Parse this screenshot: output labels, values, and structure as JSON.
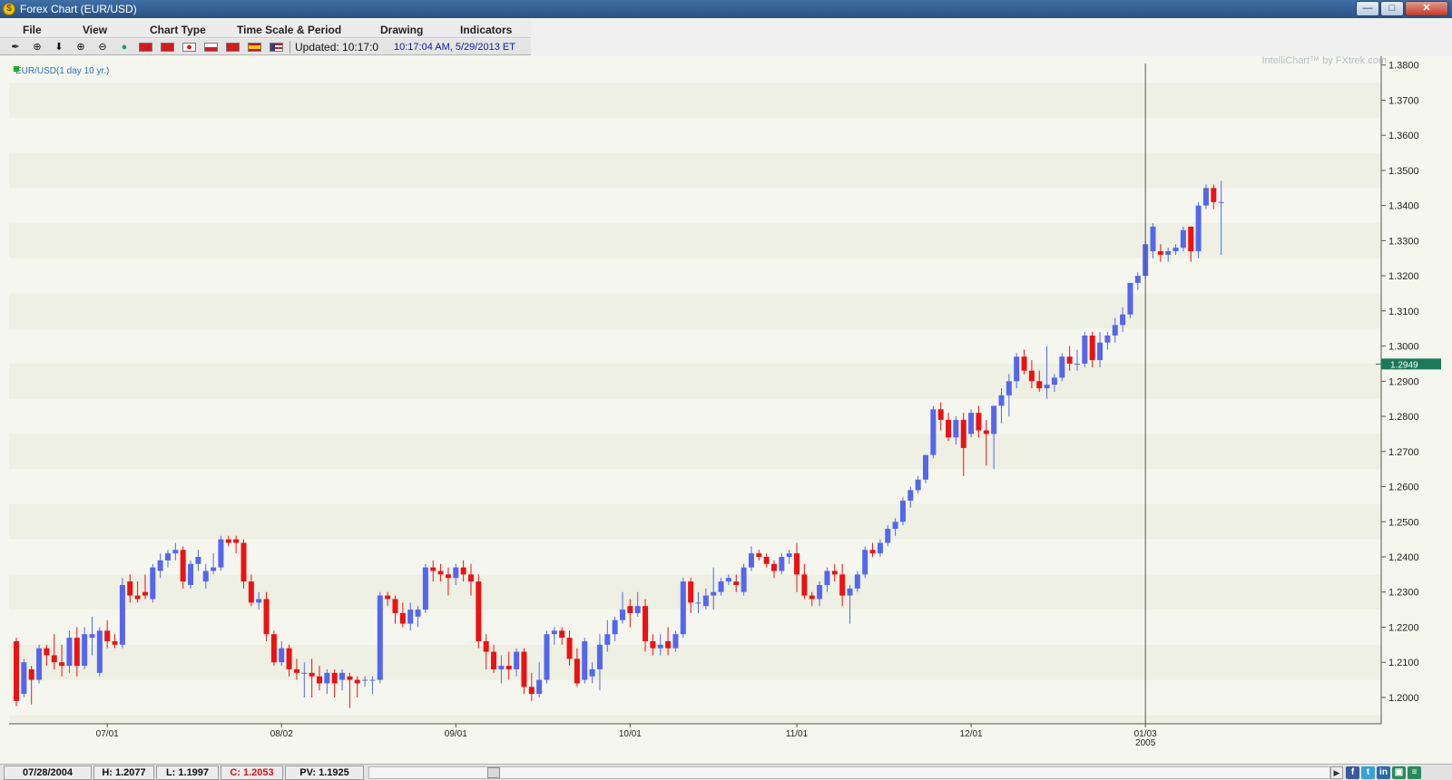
{
  "window": {
    "title": "Forex Chart (EUR/USD)",
    "icon": "fxtrek-logo-icon"
  },
  "menus": [
    "File",
    "View",
    "Chart Type",
    "Time Scale & Period",
    "Drawing",
    "Indicators"
  ],
  "toolbar": {
    "tools": [
      "pencil-icon",
      "crosshair-icon",
      "down-arrow-icon",
      "zoom-in-icon",
      "zoom-out-icon",
      "globe-icon"
    ],
    "flags": [
      {
        "name": "china-flag-icon",
        "color": "#d71920"
      },
      {
        "name": "hong-kong-flag-icon",
        "color": "#d71920"
      },
      {
        "name": "japan-flag-icon",
        "color": "#ffffff"
      },
      {
        "name": "poland-flag-icon",
        "color": "#ffffff"
      },
      {
        "name": "turkey-flag-icon",
        "color": "#d71920"
      },
      {
        "name": "spain-flag-icon",
        "color": "#e8a300"
      },
      {
        "name": "usa-flag-icon",
        "color": "#3c3b6e"
      }
    ],
    "updated_label": "Updated: 10:17:0",
    "updated_time": "10:17:04 AM, 5/29/2013 ET"
  },
  "chart": {
    "legend": "EUR/USD(1 day  10 yr.)",
    "watermark": "IntelliChart™ by FXtrek.com",
    "current_price_label": "1.2949",
    "year_label": "2005",
    "colors": {
      "up": "#5566ee",
      "down": "#ee1111",
      "price_tag": "#1a7a5a",
      "band_a": "#f5f7ef",
      "band_b": "#edf0e2"
    }
  },
  "chart_data": {
    "type": "candlestick",
    "symbol": "EUR/USD",
    "period": "1 day",
    "ylim": [
      1.1925,
      1.3825
    ],
    "yticks": [
      "1.2000",
      "1.2100",
      "1.2200",
      "1.2300",
      "1.2400",
      "1.2500",
      "1.2600",
      "1.2700",
      "1.2800",
      "1.2900",
      "1.3000",
      "1.3100",
      "1.3200",
      "1.3300",
      "1.3400",
      "1.3500",
      "1.3600",
      "1.3700",
      "1.3800"
    ],
    "xticks": [
      {
        "label": "07/01",
        "index": 12
      },
      {
        "label": "08/02",
        "index": 35
      },
      {
        "label": "09/01",
        "index": 58
      },
      {
        "label": "10/01",
        "index": 81
      },
      {
        "label": "11/01",
        "index": 103
      },
      {
        "label": "12/01",
        "index": 126
      },
      {
        "label": "01/03",
        "index": 149
      }
    ],
    "marker_index": 149,
    "current_price": 1.2949,
    "candles": [
      [
        1.216,
        1.217,
        1.1975,
        1.199
      ],
      [
        1.201,
        1.211,
        1.2,
        1.21
      ],
      [
        1.208,
        1.209,
        1.198,
        1.205
      ],
      [
        1.205,
        1.215,
        1.204,
        1.214
      ],
      [
        1.214,
        1.215,
        1.209,
        1.212
      ],
      [
        1.212,
        1.218,
        1.208,
        1.21
      ],
      [
        1.21,
        1.215,
        1.206,
        1.209
      ],
      [
        1.209,
        1.219,
        1.207,
        1.217
      ],
      [
        1.217,
        1.22,
        1.206,
        1.209
      ],
      [
        1.209,
        1.22,
        1.208,
        1.218
      ],
      [
        1.217,
        1.223,
        1.212,
        1.218
      ],
      [
        1.207,
        1.22,
        1.206,
        1.219
      ],
      [
        1.219,
        1.222,
        1.214,
        1.216
      ],
      [
        1.216,
        1.218,
        1.214,
        1.215
      ],
      [
        1.215,
        1.234,
        1.214,
        1.232
      ],
      [
        1.233,
        1.235,
        1.227,
        1.229
      ],
      [
        1.229,
        1.233,
        1.227,
        1.228
      ],
      [
        1.23,
        1.235,
        1.228,
        1.229
      ],
      [
        1.228,
        1.238,
        1.227,
        1.237
      ],
      [
        1.236,
        1.241,
        1.234,
        1.239
      ],
      [
        1.239,
        1.242,
        1.237,
        1.241
      ],
      [
        1.241,
        1.244,
        1.239,
        1.242
      ],
      [
        1.242,
        1.243,
        1.231,
        1.233
      ],
      [
        1.232,
        1.239,
        1.231,
        1.238
      ],
      [
        1.238,
        1.242,
        1.236,
        1.24
      ],
      [
        1.233,
        1.238,
        1.231,
        1.236
      ],
      [
        1.236,
        1.241,
        1.235,
        1.237
      ],
      [
        1.237,
        1.246,
        1.236,
        1.245
      ],
      [
        1.245,
        1.246,
        1.243,
        1.244
      ],
      [
        1.245,
        1.246,
        1.241,
        1.244
      ],
      [
        1.244,
        1.245,
        1.231,
        1.233
      ],
      [
        1.233,
        1.235,
        1.226,
        1.227
      ],
      [
        1.227,
        1.23,
        1.225,
        1.228
      ],
      [
        1.228,
        1.23,
        1.216,
        1.218
      ],
      [
        1.218,
        1.219,
        1.209,
        1.21
      ],
      [
        1.21,
        1.216,
        1.209,
        1.214
      ],
      [
        1.214,
        1.215,
        1.206,
        1.208
      ],
      [
        1.208,
        1.211,
        1.205,
        1.207
      ],
      [
        1.207,
        1.21,
        1.2,
        1.207
      ],
      [
        1.207,
        1.211,
        1.2,
        1.206
      ],
      [
        1.206,
        1.209,
        1.202,
        1.204
      ],
      [
        1.204,
        1.208,
        1.201,
        1.207
      ],
      [
        1.207,
        1.208,
        1.2,
        1.204
      ],
      [
        1.205,
        1.208,
        1.202,
        1.207
      ],
      [
        1.206,
        1.207,
        1.197,
        1.205
      ],
      [
        1.205,
        1.206,
        1.2,
        1.204
      ],
      [
        1.205,
        1.206,
        1.203,
        1.205
      ],
      [
        1.205,
        1.206,
        1.201,
        1.205
      ],
      [
        1.205,
        1.23,
        1.204,
        1.229
      ],
      [
        1.229,
        1.23,
        1.226,
        1.228
      ],
      [
        1.228,
        1.229,
        1.221,
        1.224
      ],
      [
        1.224,
        1.227,
        1.22,
        1.221
      ],
      [
        1.221,
        1.227,
        1.219,
        1.225
      ],
      [
        1.223,
        1.226,
        1.22,
        1.225
      ],
      [
        1.225,
        1.238,
        1.224,
        1.237
      ],
      [
        1.237,
        1.239,
        1.233,
        1.236
      ],
      [
        1.236,
        1.238,
        1.233,
        1.235
      ],
      [
        1.235,
        1.237,
        1.229,
        1.234
      ],
      [
        1.234,
        1.238,
        1.232,
        1.237
      ],
      [
        1.237,
        1.239,
        1.233,
        1.235
      ],
      [
        1.235,
        1.238,
        1.229,
        1.233
      ],
      [
        1.233,
        1.235,
        1.214,
        1.216
      ],
      [
        1.216,
        1.218,
        1.208,
        1.213
      ],
      [
        1.213,
        1.215,
        1.207,
        1.208
      ],
      [
        1.208,
        1.212,
        1.204,
        1.209
      ],
      [
        1.209,
        1.213,
        1.205,
        1.208
      ],
      [
        1.208,
        1.214,
        1.206,
        1.213
      ],
      [
        1.213,
        1.214,
        1.201,
        1.203
      ],
      [
        1.203,
        1.207,
        1.199,
        1.201
      ],
      [
        1.201,
        1.21,
        1.2,
        1.205
      ],
      [
        1.205,
        1.219,
        1.204,
        1.218
      ],
      [
        1.218,
        1.22,
        1.215,
        1.219
      ],
      [
        1.219,
        1.22,
        1.215,
        1.217
      ],
      [
        1.217,
        1.219,
        1.209,
        1.211
      ],
      [
        1.211,
        1.214,
        1.203,
        1.204
      ],
      [
        1.205,
        1.217,
        1.204,
        1.216
      ],
      [
        1.206,
        1.21,
        1.204,
        1.208
      ],
      [
        1.208,
        1.218,
        1.202,
        1.215
      ],
      [
        1.215,
        1.222,
        1.213,
        1.218
      ],
      [
        1.218,
        1.223,
        1.216,
        1.222
      ],
      [
        1.222,
        1.23,
        1.221,
        1.225
      ],
      [
        1.226,
        1.228,
        1.22,
        1.224
      ],
      [
        1.224,
        1.23,
        1.223,
        1.226
      ],
      [
        1.226,
        1.228,
        1.213,
        1.216
      ],
      [
        1.216,
        1.218,
        1.212,
        1.214
      ],
      [
        1.214,
        1.218,
        1.212,
        1.215
      ],
      [
        1.216,
        1.22,
        1.212,
        1.214
      ],
      [
        1.214,
        1.219,
        1.213,
        1.218
      ],
      [
        1.218,
        1.234,
        1.217,
        1.233
      ],
      [
        1.233,
        1.234,
        1.224,
        1.227
      ],
      [
        1.227,
        1.23,
        1.224,
        1.227
      ],
      [
        1.226,
        1.231,
        1.225,
        1.229
      ],
      [
        1.229,
        1.237,
        1.225,
        1.23
      ],
      [
        1.23,
        1.234,
        1.229,
        1.233
      ],
      [
        1.233,
        1.235,
        1.232,
        1.234
      ],
      [
        1.233,
        1.235,
        1.23,
        1.232
      ],
      [
        1.23,
        1.238,
        1.229,
        1.237
      ],
      [
        1.237,
        1.243,
        1.236,
        1.241
      ],
      [
        1.241,
        1.242,
        1.239,
        1.24
      ],
      [
        1.24,
        1.241,
        1.237,
        1.238
      ],
      [
        1.238,
        1.239,
        1.234,
        1.236
      ],
      [
        1.236,
        1.241,
        1.235,
        1.24
      ],
      [
        1.24,
        1.242,
        1.238,
        1.241
      ],
      [
        1.241,
        1.244,
        1.23,
        1.235
      ],
      [
        1.235,
        1.238,
        1.228,
        1.229
      ],
      [
        1.229,
        1.23,
        1.226,
        1.228
      ],
      [
        1.228,
        1.233,
        1.226,
        1.232
      ],
      [
        1.232,
        1.237,
        1.23,
        1.236
      ],
      [
        1.236,
        1.238,
        1.233,
        1.235
      ],
      [
        1.235,
        1.238,
        1.226,
        1.229
      ],
      [
        1.229,
        1.232,
        1.221,
        1.231
      ],
      [
        1.231,
        1.236,
        1.23,
        1.235
      ],
      [
        1.235,
        1.243,
        1.234,
        1.242
      ],
      [
        1.242,
        1.244,
        1.24,
        1.241
      ],
      [
        1.241,
        1.245,
        1.24,
        1.244
      ],
      [
        1.244,
        1.249,
        1.243,
        1.248
      ],
      [
        1.248,
        1.251,
        1.246,
        1.25
      ],
      [
        1.25,
        1.257,
        1.249,
        1.256
      ],
      [
        1.256,
        1.26,
        1.254,
        1.259
      ],
      [
        1.259,
        1.263,
        1.258,
        1.262
      ],
      [
        1.262,
        1.269,
        1.261,
        1.269
      ],
      [
        1.269,
        1.283,
        1.268,
        1.282
      ],
      [
        1.282,
        1.284,
        1.276,
        1.279
      ],
      [
        1.279,
        1.281,
        1.273,
        1.274
      ],
      [
        1.274,
        1.28,
        1.272,
        1.279
      ],
      [
        1.279,
        1.281,
        1.263,
        1.271
      ],
      [
        1.275,
        1.282,
        1.274,
        1.281
      ],
      [
        1.281,
        1.283,
        1.274,
        1.276
      ],
      [
        1.276,
        1.279,
        1.266,
        1.275
      ],
      [
        1.275,
        1.283,
        1.265,
        1.283
      ],
      [
        1.283,
        1.288,
        1.278,
        1.286
      ],
      [
        1.286,
        1.292,
        1.28,
        1.29
      ],
      [
        1.29,
        1.298,
        1.288,
        1.297
      ],
      [
        1.297,
        1.299,
        1.292,
        1.293
      ],
      [
        1.293,
        1.296,
        1.288,
        1.29
      ],
      [
        1.29,
        1.293,
        1.287,
        1.288
      ],
      [
        1.288,
        1.3,
        1.285,
        1.289
      ],
      [
        1.289,
        1.292,
        1.287,
        1.291
      ],
      [
        1.291,
        1.298,
        1.29,
        1.297
      ],
      [
        1.297,
        1.3,
        1.293,
        1.295
      ],
      [
        1.295,
        1.299,
        1.293,
        1.295
      ],
      [
        1.295,
        1.304,
        1.294,
        1.303
      ],
      [
        1.303,
        1.304,
        1.294,
        1.296
      ],
      [
        1.296,
        1.304,
        1.294,
        1.301
      ],
      [
        1.301,
        1.304,
        1.299,
        1.303
      ],
      [
        1.303,
        1.308,
        1.301,
        1.306
      ],
      [
        1.306,
        1.311,
        1.304,
        1.309
      ],
      [
        1.309,
        1.318,
        1.308,
        1.318
      ],
      [
        1.318,
        1.321,
        1.316,
        1.32
      ],
      [
        1.32,
        1.33,
        1.319,
        1.329
      ],
      [
        1.327,
        1.335,
        1.325,
        1.334
      ],
      [
        1.327,
        1.329,
        1.324,
        1.326
      ],
      [
        1.326,
        1.328,
        1.324,
        1.327
      ],
      [
        1.327,
        1.329,
        1.326,
        1.328
      ],
      [
        1.328,
        1.334,
        1.327,
        1.333
      ],
      [
        1.334,
        1.334,
        1.324,
        1.327
      ],
      [
        1.327,
        1.341,
        1.325,
        1.34
      ],
      [
        1.34,
        1.346,
        1.339,
        1.345
      ],
      [
        1.345,
        1.346,
        1.339,
        1.341
      ],
      [
        1.341,
        1.347,
        1.326,
        1.341
      ]
    ]
  },
  "statusbar": {
    "date": "07/28/2004",
    "high": "H: 1.2077",
    "low": "L: 1.1997",
    "close": "C: 1.2053",
    "pv": "PV: 1.1925"
  }
}
